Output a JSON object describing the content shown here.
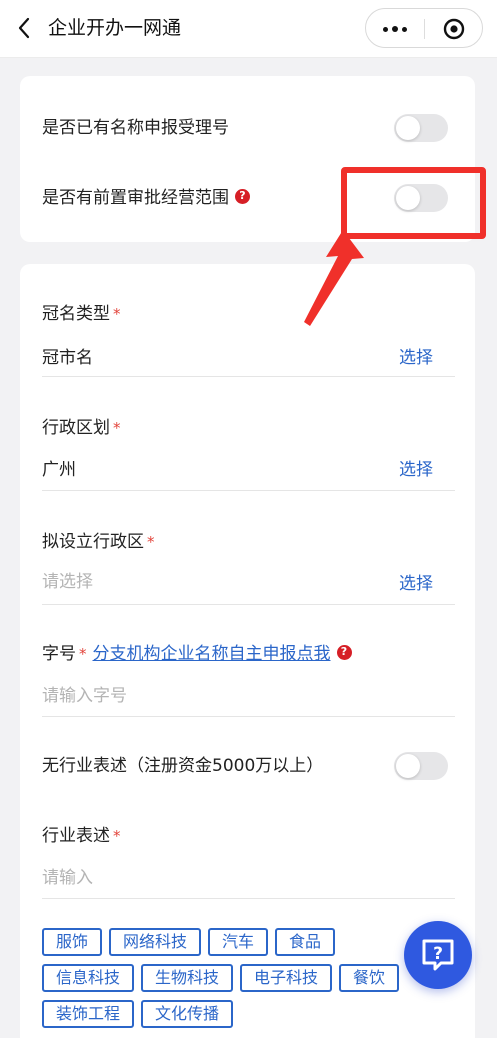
{
  "nav": {
    "title": "企业开办一网通"
  },
  "top_card": {
    "has_name_number_label": "是否已有名称申报受理号",
    "has_name_number_on": false,
    "pre_approval_label": "是否有前置审批经营范围",
    "pre_approval_on": false
  },
  "form": {
    "crown_type": {
      "label": "冠名类型",
      "value": "冠市名",
      "action": "选择"
    },
    "district": {
      "label": "行政区划",
      "value": "广州",
      "action": "选择"
    },
    "proposed_district": {
      "label": "拟设立行政区",
      "placeholder": "请选择",
      "action": "选择"
    },
    "trade_name": {
      "label": "字号",
      "link": "分支机构企业名称自主申报点我",
      "placeholder": "请输入字号"
    },
    "no_industry": {
      "label": "无行业表述（注册资金5000万以上）",
      "on": false
    },
    "industry": {
      "label": "行业表述",
      "placeholder": "请输入"
    },
    "required_mark": "*",
    "tags": [
      "服饰",
      "网络科技",
      "汽车",
      "食品",
      "信息科技",
      "生物科技",
      "电子科技",
      "餐饮",
      "装饰工程",
      "文化传播"
    ]
  },
  "help_glyph": "?",
  "colors": {
    "accent": "#2b66c9",
    "required": "#e2453c",
    "annotation": "#f0302a",
    "fab": "#2f59e0"
  }
}
